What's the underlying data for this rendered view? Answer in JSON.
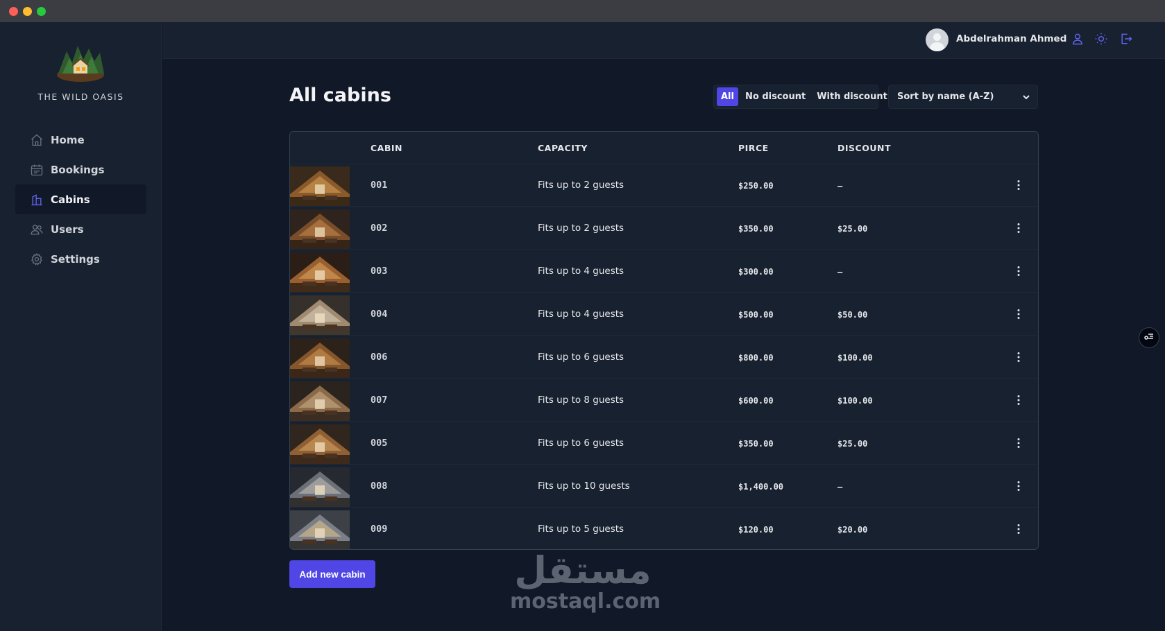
{
  "brand": {
    "name": "THE WILD OASIS"
  },
  "nav": {
    "items": [
      {
        "label": "Home",
        "icon": "home-icon"
      },
      {
        "label": "Bookings",
        "icon": "calendar-icon"
      },
      {
        "label": "Cabins",
        "icon": "buildings-icon"
      },
      {
        "label": "Users",
        "icon": "users-icon"
      },
      {
        "label": "Settings",
        "icon": "gear-icon"
      }
    ],
    "active": "Cabins"
  },
  "header": {
    "username": "Abdelrahman Ahmed",
    "icons": [
      "user-icon",
      "sun-icon",
      "logout-icon"
    ]
  },
  "page": {
    "title": "All cabins"
  },
  "filter": {
    "options": [
      "All",
      "No discount",
      "With discount"
    ],
    "active": "All"
  },
  "sort": {
    "selected": "Sort by name (A-Z)"
  },
  "table": {
    "headers": {
      "cabin": "CABIN",
      "capacity": "CAPACITY",
      "price": "PIRCE",
      "discount": "DISCOUNT"
    },
    "rows": [
      {
        "name": "001",
        "capacity": "Fits up to 2 guests",
        "price": "$250.00",
        "discount": "—"
      },
      {
        "name": "002",
        "capacity": "Fits up to 2 guests",
        "price": "$350.00",
        "discount": "$25.00"
      },
      {
        "name": "003",
        "capacity": "Fits up to 4 guests",
        "price": "$300.00",
        "discount": "—"
      },
      {
        "name": "004",
        "capacity": "Fits up to 4 guests",
        "price": "$500.00",
        "discount": "$50.00"
      },
      {
        "name": "006",
        "capacity": "Fits up to 6 guests",
        "price": "$800.00",
        "discount": "$100.00"
      },
      {
        "name": "007",
        "capacity": "Fits up to 8 guests",
        "price": "$600.00",
        "discount": "$100.00"
      },
      {
        "name": "005",
        "capacity": "Fits up to 6 guests",
        "price": "$350.00",
        "discount": "$25.00"
      },
      {
        "name": "008",
        "capacity": "Fits up to 10 guests",
        "price": "$1,400.00",
        "discount": "—"
      },
      {
        "name": "009",
        "capacity": "Fits up to 5 guests",
        "price": "$120.00",
        "discount": "$20.00"
      }
    ]
  },
  "actions": {
    "add_cabin": "Add new cabin"
  },
  "watermark": {
    "arabic": "مستقل",
    "latin": "mostaql.com"
  },
  "colors": {
    "accent": "#4f46e5",
    "background": "#111827",
    "surface": "#18212f"
  }
}
